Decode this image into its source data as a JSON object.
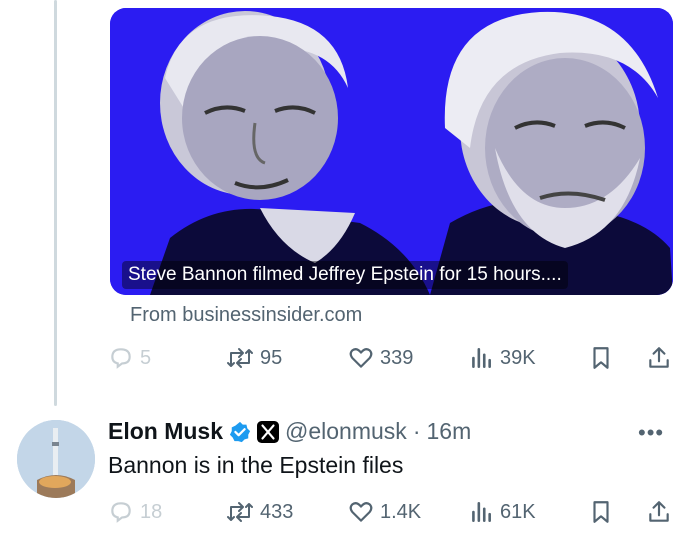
{
  "quoted_card": {
    "caption": "Steve Bannon filmed Jeffrey Epstein for 15 hours....",
    "source": "From businessinsider.com"
  },
  "first_actions": {
    "replies": "5",
    "reposts": "95",
    "likes": "339",
    "views": "39K"
  },
  "post": {
    "author_name": "Elon Musk",
    "handle": "@elonmusk",
    "separator": "·",
    "time": "16m",
    "text": "Bannon is in the Epstein files"
  },
  "post_actions": {
    "replies": "18",
    "reposts": "433",
    "likes": "1.4K",
    "views": "61K"
  },
  "colors": {
    "card_bg": "#2b1cf2",
    "verified_blue": "#1d9bf0",
    "muted_text": "#536471",
    "thread_line": "#cfd9de"
  },
  "icons": [
    "reply-icon",
    "repost-icon",
    "like-icon",
    "views-icon",
    "bookmark-icon",
    "share-icon",
    "verified-icon",
    "x-logo-icon",
    "more-icon"
  ]
}
